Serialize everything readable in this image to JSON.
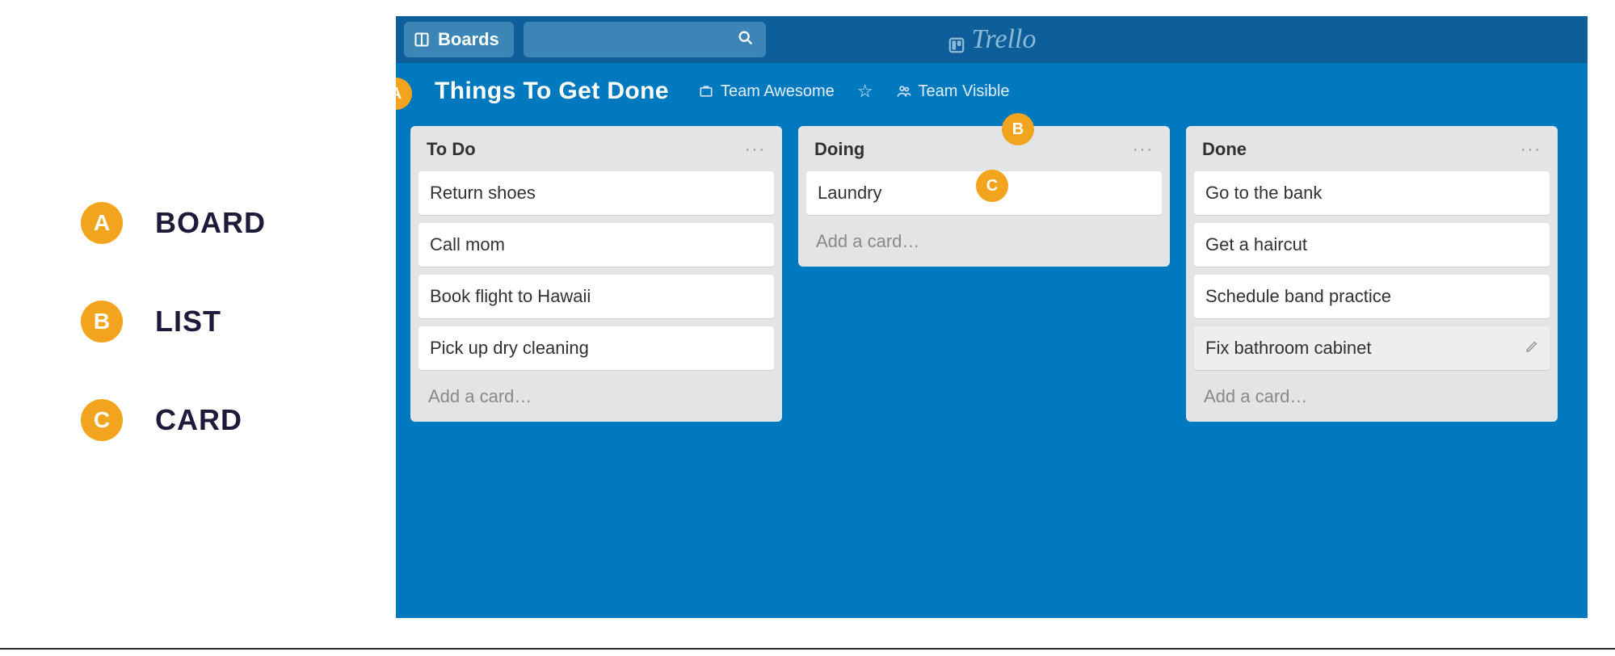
{
  "legend": [
    {
      "letter": "A",
      "label": "BOARD"
    },
    {
      "letter": "B",
      "label": "LIST"
    },
    {
      "letter": "C",
      "label": "CARD"
    }
  ],
  "topbar": {
    "boards_label": "Boards",
    "logo_text": "Trello"
  },
  "board": {
    "title": "Things To Get Done",
    "team_label": "Team Awesome",
    "visibility_label": "Team Visible"
  },
  "lists": [
    {
      "title": "To Do",
      "cards": [
        "Return shoes",
        "Call mom",
        "Book flight to Hawaii",
        "Pick up dry cleaning"
      ],
      "add_label": "Add a card…"
    },
    {
      "title": "Doing",
      "cards": [
        "Laundry"
      ],
      "add_label": "Add a card…"
    },
    {
      "title": "Done",
      "cards": [
        "Go to the bank",
        "Get a haircut",
        "Schedule band practice",
        "Fix bathroom cabinet"
      ],
      "add_label": "Add a card…"
    }
  ],
  "overlay_letters": {
    "a": "A",
    "b": "B",
    "c": "C"
  }
}
